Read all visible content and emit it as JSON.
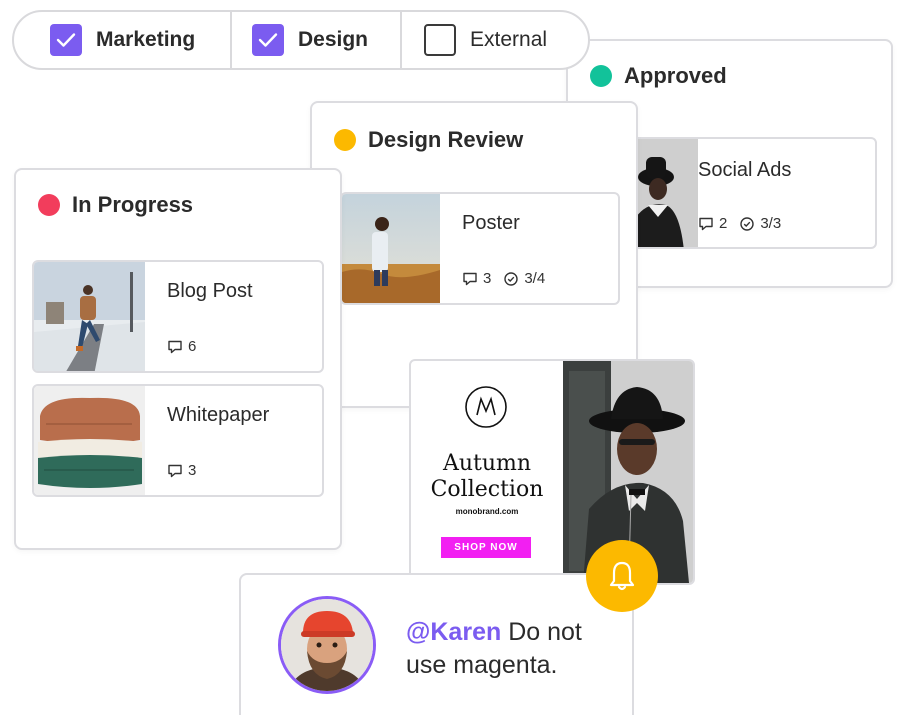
{
  "filters": [
    {
      "label": "Marketing",
      "checked": true
    },
    {
      "label": "Design",
      "checked": true
    },
    {
      "label": "External",
      "checked": false
    }
  ],
  "columns": {
    "approved": {
      "title": "Approved",
      "dot_color": "#12c29a",
      "cards": [
        {
          "title": "Social Ads",
          "comments": "2",
          "tasks": "3/3"
        }
      ]
    },
    "design_review": {
      "title": "Design Review",
      "dot_color": "#fcb900",
      "cards": [
        {
          "title": "Poster",
          "comments": "3",
          "tasks": "3/4"
        }
      ]
    },
    "in_progress": {
      "title": "In Progress",
      "dot_color": "#f23d5c",
      "cards": [
        {
          "title": "Blog Post",
          "comments": "6"
        },
        {
          "title": "Whitepaper",
          "comments": "3"
        }
      ]
    }
  },
  "ad": {
    "headline_line1": "Autumn",
    "headline_line2": "Collection",
    "site": "monobrand.com",
    "cta": "SHOP NOW",
    "cta_color": "#f21ff2"
  },
  "comment": {
    "mention": "@Karen",
    "text": " Do not use magenta."
  },
  "colors": {
    "accent": "#7b5cf0",
    "bell": "#fcb900"
  },
  "icons": [
    "check-icon",
    "comment-icon",
    "task-check-icon",
    "bell-icon",
    "monogram-logo-icon"
  ]
}
